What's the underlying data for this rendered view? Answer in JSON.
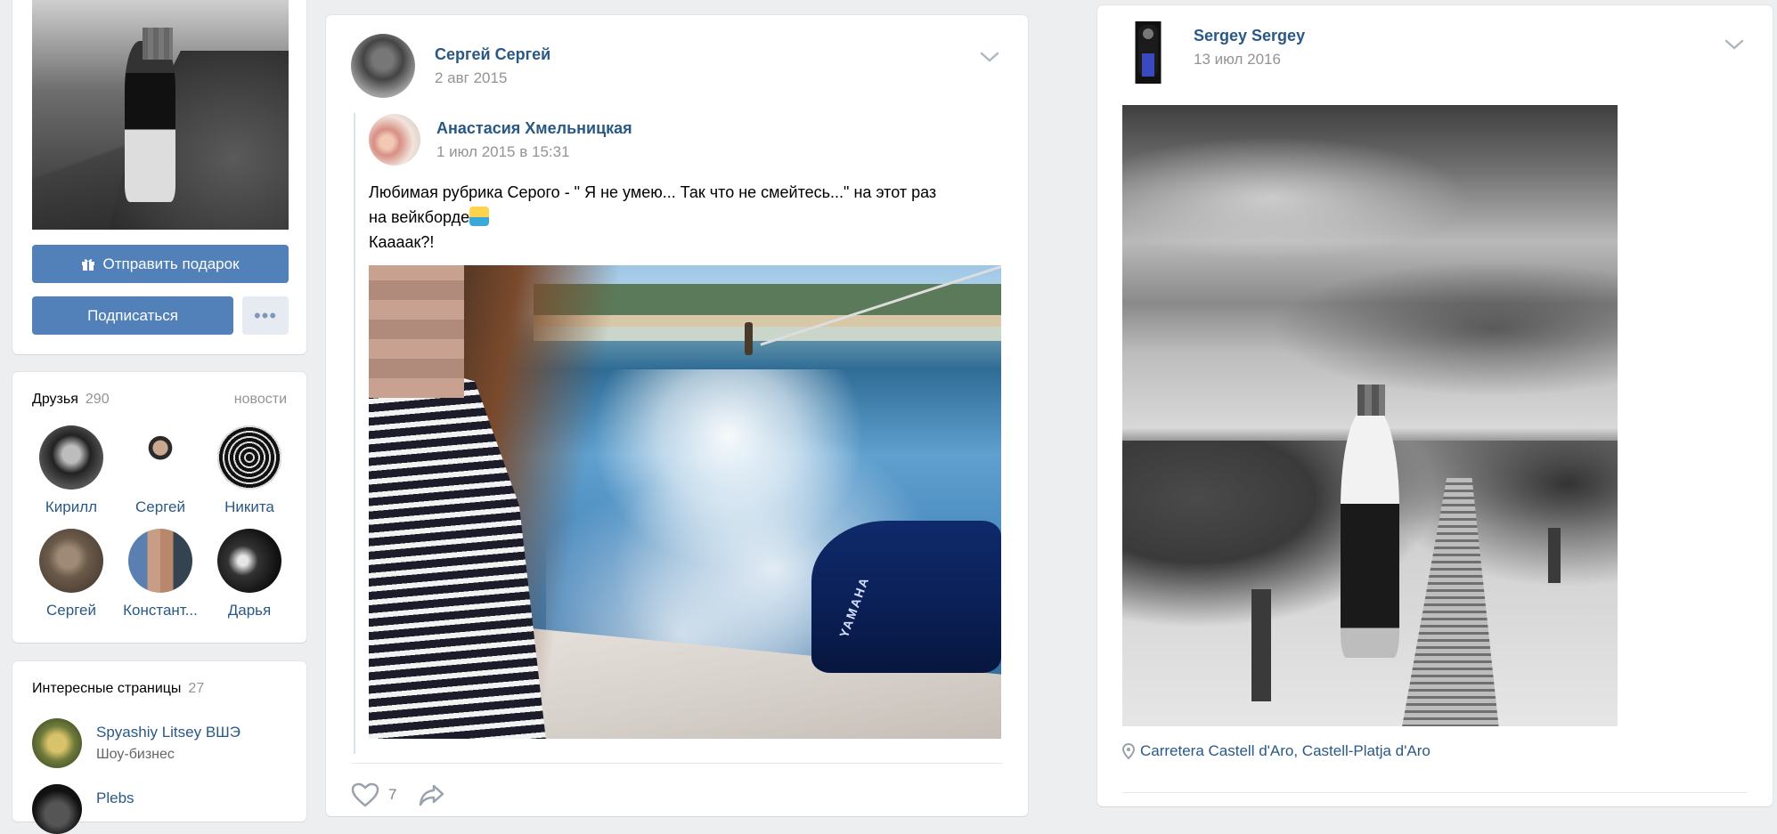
{
  "profile": {
    "gift_button_label": "Отправить подарок",
    "subscribe_button_label": "Подписаться",
    "more_button_label": "•••"
  },
  "friends": {
    "title": "Друзья",
    "count": "290",
    "news_link": "новости",
    "items": [
      {
        "name": "Кирилл"
      },
      {
        "name": "Сергей"
      },
      {
        "name": "Никита"
      },
      {
        "name": "Сергей"
      },
      {
        "name": "Констант..."
      },
      {
        "name": "Дарья"
      }
    ]
  },
  "interesting_pages": {
    "title": "Интересные страницы",
    "count": "27",
    "items": [
      {
        "title": "Spyashiy Litsey ВШЭ",
        "subtitle": "Шоу-бизнес"
      },
      {
        "title": "Plebs",
        "subtitle": ""
      }
    ]
  },
  "post_middle": {
    "author": "Сергей Сергей",
    "date": "2 авг 2015",
    "repost": {
      "author": "Анастасия Хмельницкая",
      "date": "1 июл 2015 в 15:31",
      "text_line1": "Любимая рубрика Серого - \" Я не умею... Так что не смейтесь...\" на этот раз",
      "text_line2": "на вейкборде",
      "text_line3": "Кааaак?!",
      "photo_label": "YAMAHA"
    },
    "likes": "7"
  },
  "post_right": {
    "author": "Sergey Sergey",
    "date": "13 июл 2016",
    "location": "Carretera Castell d'Aro, Castell-Platja d'Aro"
  },
  "colors": {
    "accent": "#5181b8",
    "link": "#2a5885",
    "muted": "#939393",
    "background": "#edeef0"
  }
}
